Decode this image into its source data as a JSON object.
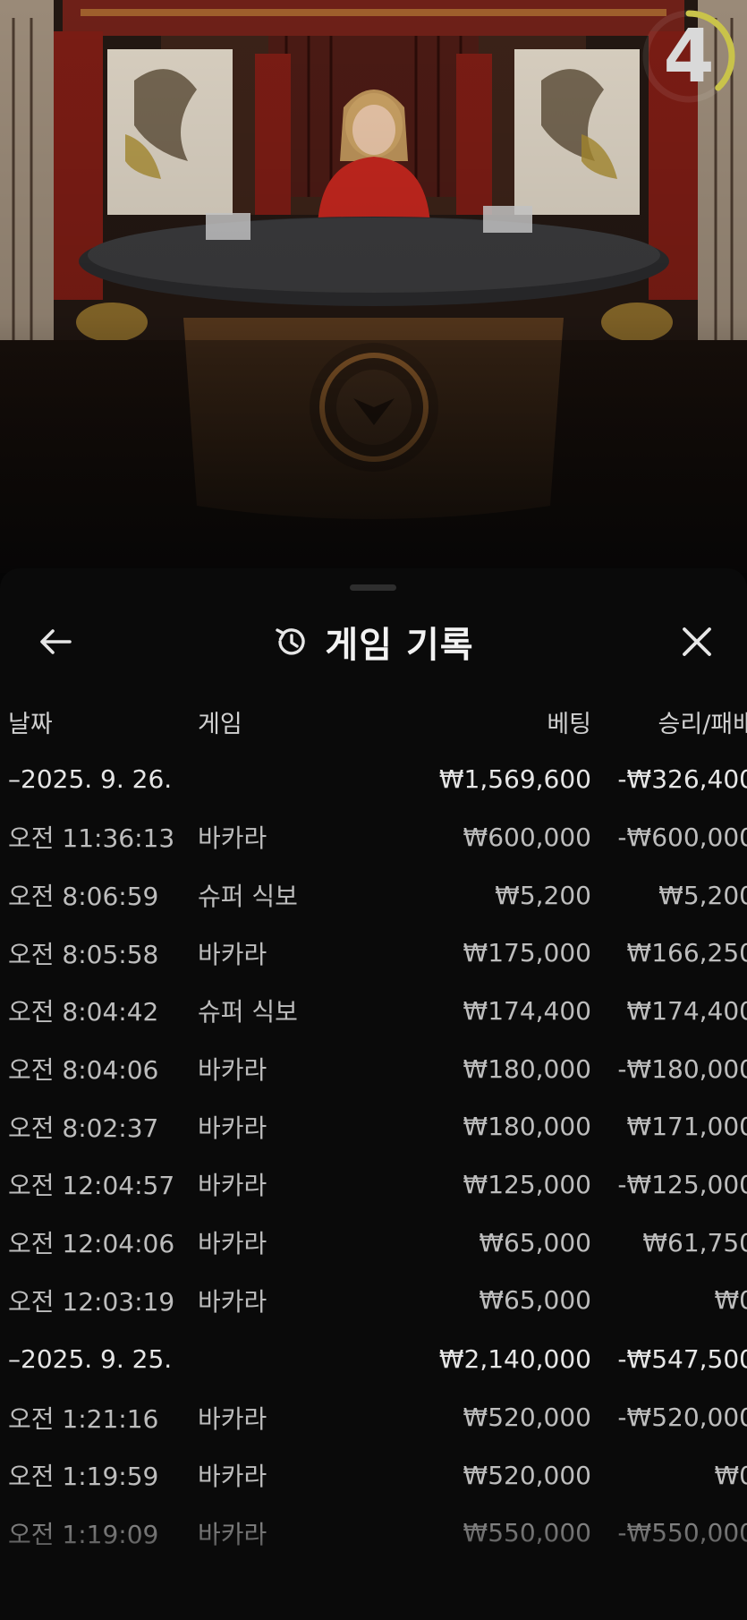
{
  "countdown": {
    "value": "4",
    "progress": 0.38
  },
  "panel": {
    "title": "게임 기록",
    "back_icon": "arrow-left-icon",
    "history_icon": "history-icon",
    "close_icon": "close-icon"
  },
  "table": {
    "headers": {
      "date": "날짜",
      "game": "게임",
      "bet": "베팅",
      "result": "승리/패배"
    },
    "rows": [
      {
        "type": "date",
        "date": "–2025. 9. 26.",
        "game": "",
        "bet": "₩1,569,600",
        "result": "-₩326,400"
      },
      {
        "type": "game",
        "date": "오전 11:36:13",
        "game": "바카라",
        "bet": "₩600,000",
        "result": "-₩600,000"
      },
      {
        "type": "game",
        "date": "오전 8:06:59",
        "game": "슈퍼 식보",
        "bet": "₩5,200",
        "result": "₩5,200"
      },
      {
        "type": "game",
        "date": "오전 8:05:58",
        "game": "바카라",
        "bet": "₩175,000",
        "result": "₩166,250"
      },
      {
        "type": "game",
        "date": "오전 8:04:42",
        "game": "슈퍼 식보",
        "bet": "₩174,400",
        "result": "₩174,400"
      },
      {
        "type": "game",
        "date": "오전 8:04:06",
        "game": "바카라",
        "bet": "₩180,000",
        "result": "-₩180,000"
      },
      {
        "type": "game",
        "date": "오전 8:02:37",
        "game": "바카라",
        "bet": "₩180,000",
        "result": "₩171,000"
      },
      {
        "type": "game",
        "date": "오전 12:04:57",
        "game": "바카라",
        "bet": "₩125,000",
        "result": "-₩125,000"
      },
      {
        "type": "game",
        "date": "오전 12:04:06",
        "game": "바카라",
        "bet": "₩65,000",
        "result": "₩61,750"
      },
      {
        "type": "game",
        "date": "오전 12:03:19",
        "game": "바카라",
        "bet": "₩65,000",
        "result": "₩0"
      },
      {
        "type": "date",
        "date": "–2025. 9. 25.",
        "game": "",
        "bet": "₩2,140,000",
        "result": "-₩547,500"
      },
      {
        "type": "game",
        "date": "오전 1:21:16",
        "game": "바카라",
        "bet": "₩520,000",
        "result": "-₩520,000"
      },
      {
        "type": "game",
        "date": "오전 1:19:59",
        "game": "바카라",
        "bet": "₩520,000",
        "result": "₩0"
      },
      {
        "type": "game",
        "date": "오전 1:19:09",
        "game": "바카라",
        "bet": "₩550,000",
        "result": "-₩550,000"
      }
    ]
  }
}
